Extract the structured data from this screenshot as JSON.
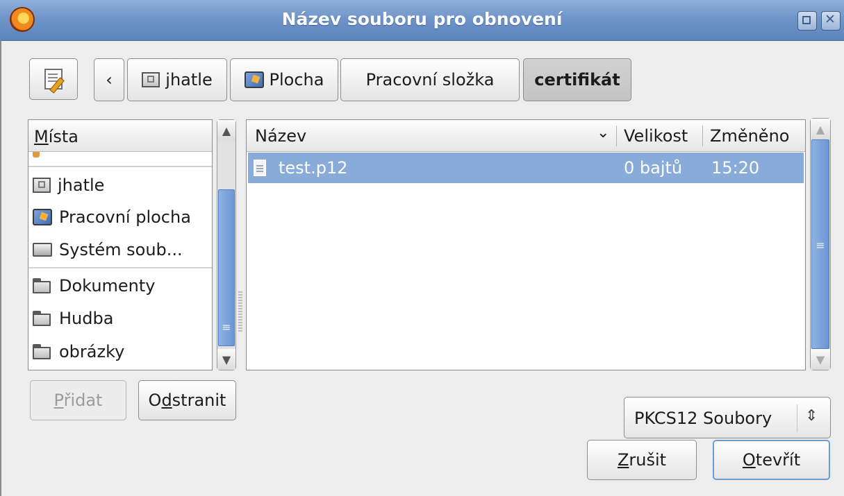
{
  "window": {
    "title": "Název souboru pro obnovení"
  },
  "icons": {
    "app": "firefox-icon",
    "edit": "text-edit-icon",
    "folder": "folder-icon",
    "home": "home-folder-icon",
    "desktop": "desktop-icon",
    "disk": "harddisk-icon",
    "file": "file-icon"
  },
  "pathbar": {
    "back_label": "‹",
    "crumbs": [
      "jhatle",
      "Plocha",
      "Pracovní složka",
      "certifikát"
    ]
  },
  "places": {
    "header": "Místa",
    "header_mnemonic": "M",
    "header_rest": "ísta",
    "items": [
      {
        "label": "jhatle",
        "icon": "home-folder-icon"
      },
      {
        "label": "Pracovní plocha",
        "icon": "desktop-icon"
      },
      {
        "label": "Systém soub...",
        "icon": "harddisk-icon"
      },
      {
        "label": "Dokumenty",
        "icon": "folder-icon"
      },
      {
        "label": "Hudba",
        "icon": "folder-icon"
      },
      {
        "label": "obrázky",
        "icon": "folder-icon"
      }
    ]
  },
  "files": {
    "columns": [
      "Název",
      "Velikost",
      "Změněno"
    ],
    "sort_indicator": "⌄",
    "rows": [
      {
        "name": "test.p12",
        "size": "0 bajtů",
        "modified": "15:20",
        "selected": true
      }
    ]
  },
  "buttons": {
    "add": {
      "mn": "P",
      "rest": "řidat",
      "disabled": true
    },
    "remove": {
      "pre": "O",
      "mn": "d",
      "rest": "stranit"
    },
    "cancel": {
      "mn": "Z",
      "rest": "rušit"
    },
    "open": {
      "mn": "O",
      "rest": "tevřít"
    }
  },
  "filter": {
    "selected": "PKCS12 Soubory",
    "chevron": "⇕"
  },
  "colors": {
    "titlebar": "#6f95c8",
    "selection": "#88abd9",
    "scroll_thumb": "#7aa3da"
  }
}
